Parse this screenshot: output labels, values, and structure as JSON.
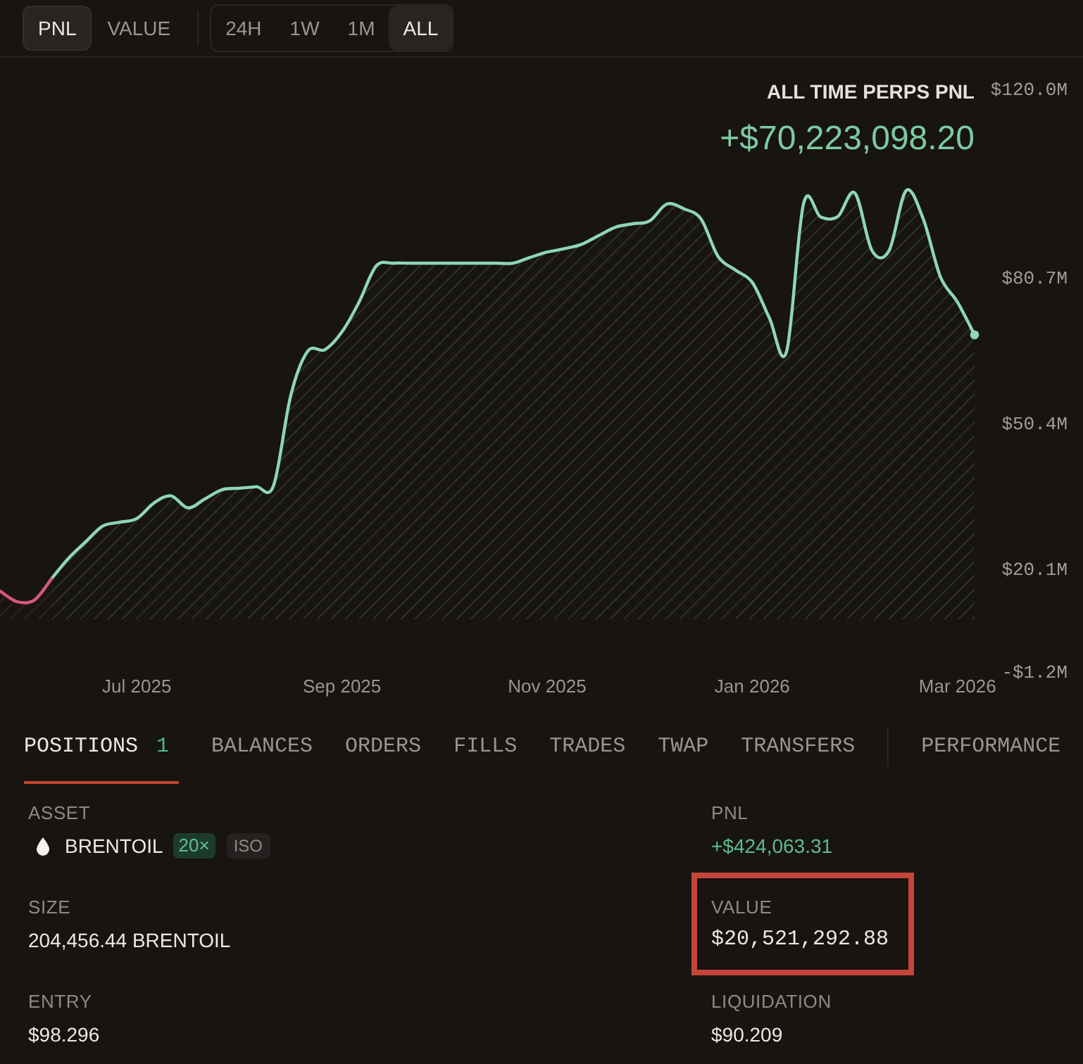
{
  "view_toggle": [
    {
      "label": "PNL",
      "selected": true
    },
    {
      "label": "VALUE",
      "selected": false
    }
  ],
  "range_toggle": [
    {
      "label": "24H",
      "selected": false
    },
    {
      "label": "1W",
      "selected": false
    },
    {
      "label": "1M",
      "selected": false
    },
    {
      "label": "ALL",
      "selected": true
    }
  ],
  "chart": {
    "total": "+$70,223,098.20",
    "chart_data": {
      "type": "area",
      "title": "ALL TIME PERPS PNL",
      "categories": [
        null,
        null,
        null,
        null,
        null,
        null,
        null,
        null,
        "Jul 2025",
        null,
        null,
        null,
        null,
        null,
        null,
        null,
        null,
        null,
        null,
        null,
        "Sep 2025",
        null,
        null,
        null,
        null,
        null,
        null,
        null,
        null,
        null,
        null,
        null,
        "Nov 2025",
        null,
        null,
        null,
        null,
        null,
        null,
        null,
        null,
        null,
        null,
        null,
        "Jan 2026",
        null,
        null,
        null,
        null,
        null,
        null,
        null,
        null,
        null,
        null,
        null,
        "Mar 2026",
        null
      ],
      "series": [
        {
          "color": "#8fd6b4",
          "values": [
            null,
            null,
            null,
            18.0,
            22.3,
            25.7,
            29.0,
            29.8,
            30.6,
            33.8,
            35.3,
            32.8,
            34.7,
            36.6,
            36.9,
            37.2,
            37.4,
            56.1,
            65.4,
            65.7,
            69.4,
            75.6,
            83.1,
            83.7,
            83.7,
            83.7,
            83.7,
            83.7,
            83.7,
            83.7,
            83.7,
            84.9,
            86.0,
            86.7,
            87.6,
            89.4,
            91.2,
            91.9,
            92.5,
            96.0,
            95.0,
            92.9,
            85.1,
            82.3,
            79.7,
            72.3,
            65.3,
            96.1,
            93.3,
            93.4,
            98.3,
            86.3,
            86.3,
            98.8,
            92.9,
            80.9,
            75.6,
            68.8
          ]
        },
        {
          "color": "#d65a7c",
          "values": [
            15.5,
            13.3,
            13.6,
            18.0,
            null,
            null,
            null,
            null,
            null,
            null,
            null,
            null,
            null,
            null,
            null,
            null,
            null,
            null,
            null,
            null,
            null,
            null,
            null,
            null,
            null,
            null,
            null,
            null,
            null,
            null,
            null,
            null,
            null,
            null,
            null,
            null,
            null,
            null,
            null,
            null,
            null,
            null,
            null,
            null,
            null,
            null,
            null,
            null,
            null,
            null,
            null,
            null,
            null,
            null,
            null,
            null,
            null,
            null
          ]
        }
      ],
      "ylim": [
        -1.2,
        120.0
      ],
      "yticks": [
        {
          "value": 120.0,
          "label": "$120.0M"
        },
        {
          "value": 80.7,
          "label": "$80.7M"
        },
        {
          "value": 50.4,
          "label": "$50.4M"
        },
        {
          "value": 20.1,
          "label": "$20.1M"
        },
        {
          "value": -1.2,
          "label": "-$1.2M"
        }
      ]
    }
  },
  "tabs": [
    {
      "label": "POSITIONS",
      "count": "1",
      "selected": true
    },
    {
      "label": "BALANCES",
      "selected": false
    },
    {
      "label": "ORDERS",
      "selected": false
    },
    {
      "label": "FILLS",
      "selected": false
    },
    {
      "label": "TRADES",
      "selected": false
    },
    {
      "label": "TWAP",
      "selected": false
    },
    {
      "label": "TRANSFERS",
      "selected": false
    }
  ],
  "tabs_right": [
    {
      "label": "PERFORMANCE",
      "selected": false
    }
  ],
  "position": {
    "fields": [
      {
        "label": "ASSET",
        "kind": "asset",
        "value": "BRENTOIL",
        "badges": [
          {
            "text": "20×",
            "kind": "leverage"
          },
          {
            "text": "ISO",
            "kind": "margin"
          }
        ],
        "highlighted": false
      },
      {
        "label": "PNL",
        "kind": "gain",
        "value": "+$424,063.31",
        "highlighted": false
      },
      {
        "label": "SIZE",
        "kind": "text",
        "value": "204,456.44 BRENTOIL",
        "highlighted": false
      },
      {
        "label": "VALUE",
        "kind": "amount",
        "value": "$20,521,292.88",
        "highlighted": true
      },
      {
        "label": "ENTRY",
        "kind": "text",
        "value": "$98.296",
        "highlighted": false
      },
      {
        "label": "LIQUIDATION",
        "kind": "text",
        "value": "$90.209",
        "highlighted": false
      }
    ]
  }
}
